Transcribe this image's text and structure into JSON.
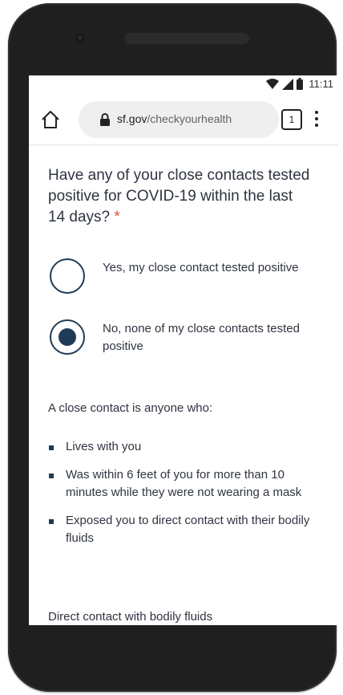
{
  "status_bar": {
    "time": "11:11",
    "icons": [
      "wifi-icon",
      "signal-icon",
      "battery-icon"
    ]
  },
  "browser": {
    "url_domain": "sf.gov",
    "url_path": "/checkyourhealth",
    "tab_count": "1",
    "icons": [
      "home-icon",
      "lock-icon",
      "menu-icon"
    ]
  },
  "form": {
    "question": "Have any of your close contacts tested positive for COVID-19 within the last 14 days?",
    "required_mark": "*",
    "options": [
      {
        "label": "Yes, my close contact tested positive",
        "selected": false
      },
      {
        "label": "No, none of my close contacts tested positive",
        "selected": true
      }
    ]
  },
  "info": {
    "intro": "A close contact is anyone who:",
    "bullets": [
      "Lives with you",
      "Was within 6 feet of you for more than 10 minutes while they were not wearing a mask",
      "Exposed you to direct contact with their bodily fluids"
    ],
    "footer": "Direct contact with bodily fluids"
  },
  "colors": {
    "accent": "#1f3b55",
    "required": "#e14e3d",
    "text": "#2e3440",
    "frame": "#1f1f1f"
  }
}
